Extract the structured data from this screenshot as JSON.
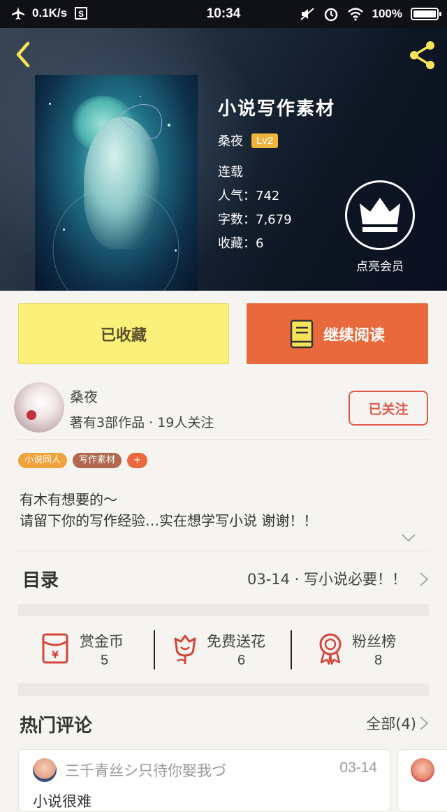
{
  "status_bar": {
    "speed": "0.1K/s",
    "time": "10:34",
    "battery": "100%"
  },
  "book": {
    "title": "小说写作素材",
    "author": "桑夜",
    "level": "Lv2",
    "status": "连载",
    "popularity": "人气：742",
    "words": "字数：7,679",
    "favorites": "收藏：6"
  },
  "vip": {
    "label": "点亮会员"
  },
  "actions": {
    "favorite_label": "已收藏",
    "read_label": "继续阅读"
  },
  "author_row": {
    "name": "桑夜",
    "info": "著有3部作品 · 19人关注",
    "follow_label": "已关注"
  },
  "tags": [
    {
      "label": "小说同人",
      "color": "#f0a23b"
    },
    {
      "label": "写作素材",
      "color": "#b0684e"
    },
    {
      "label": "+",
      "color": "#e9693c"
    }
  ],
  "description": {
    "line1": "有木有想要的～",
    "line2": "请留下你的写作经验…实在想学写小说 谢谢！！"
  },
  "toc": {
    "title": "目录",
    "latest": "03-14 · 写小说必要！！"
  },
  "stats": [
    {
      "label": "赏金币",
      "value": "5",
      "icon": "red-envelope-icon"
    },
    {
      "label": "免费送花",
      "value": "6",
      "icon": "flower-icon"
    },
    {
      "label": "粉丝榜",
      "value": "8",
      "icon": "medal-icon"
    }
  ],
  "comments": {
    "title": "热门评论",
    "all_label": "全部(4)",
    "items": [
      {
        "user": "三千青丝シ只待你娶我づ",
        "date": "03-14",
        "preview": "小说很难"
      }
    ]
  },
  "colors": {
    "accent": "#e9693c",
    "fav_button": "#fbf17a",
    "follow": "#e05a4c",
    "level_badge": "#f1b43a"
  }
}
